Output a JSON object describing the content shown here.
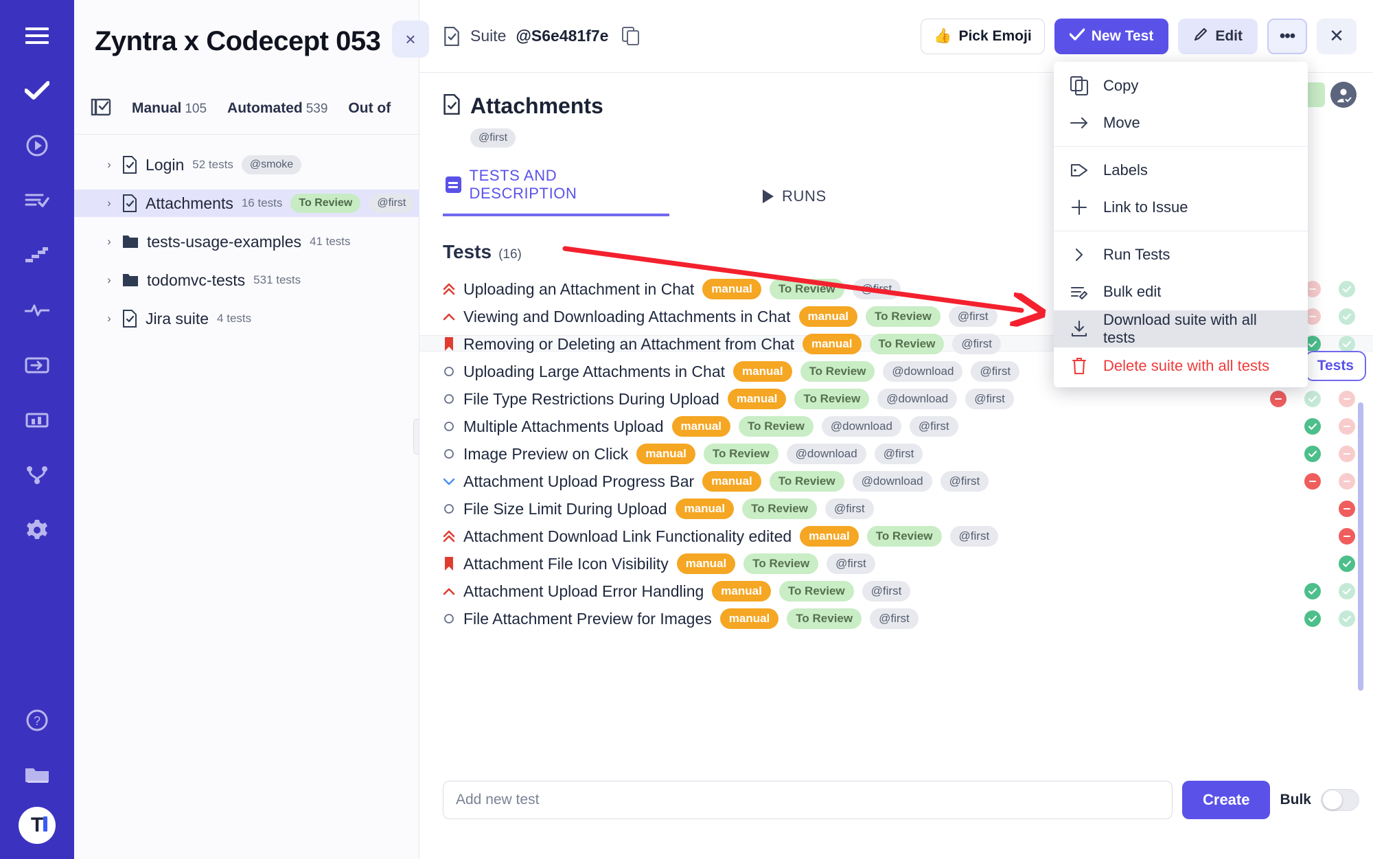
{
  "rail": {
    "icons": [
      {
        "name": "hamburger-menu-icon"
      },
      {
        "name": "check-icon"
      },
      {
        "name": "play-circle-icon"
      },
      {
        "name": "list-check-icon"
      },
      {
        "name": "steps-icon"
      },
      {
        "name": "activity-pulse-icon"
      },
      {
        "name": "import-icon"
      },
      {
        "name": "chart-bar-icon"
      },
      {
        "name": "share-nodes-icon"
      },
      {
        "name": "gear-icon"
      },
      {
        "name": "help-circle-icon"
      },
      {
        "name": "folder-icon"
      }
    ],
    "logo_letter": "T"
  },
  "panel": {
    "title": "Zyntra x Codecept 053",
    "close_label": "×",
    "tabs": [
      {
        "label": "Manual",
        "count": "105"
      },
      {
        "label": "Automated",
        "count": "539"
      },
      {
        "label": "Out of",
        "count": ""
      }
    ],
    "tree": [
      {
        "name": "Login",
        "count": "52 tests",
        "icon": "file-check-icon",
        "tags": [
          {
            "text": "@smoke",
            "kind": "grey"
          }
        ],
        "selected": false
      },
      {
        "name": "Attachments",
        "count": "16 tests",
        "icon": "file-check-icon",
        "tags": [
          {
            "text": "To Review",
            "kind": "green"
          },
          {
            "text": "@first",
            "kind": "grey"
          }
        ],
        "selected": true
      },
      {
        "name": "tests-usage-examples",
        "count": "41 tests",
        "icon": "folder-icon",
        "tags": [],
        "selected": false
      },
      {
        "name": "todomvc-tests",
        "count": "531 tests",
        "icon": "folder-icon",
        "tags": [],
        "selected": false
      },
      {
        "name": "Jira suite",
        "count": "4 tests",
        "icon": "file-check-icon",
        "tags": [],
        "selected": false
      }
    ]
  },
  "header": {
    "suite_word": "Suite",
    "suite_id": "@S6e481f7e",
    "buttons": {
      "pick_emoji": "Pick Emoji",
      "emoji_glyph": "👍",
      "new_test": "New Test",
      "edit": "Edit",
      "more": "•••",
      "close": "✕"
    }
  },
  "suite": {
    "title": "Attachments",
    "tag": "@first",
    "tabs": [
      {
        "label": "TESTS AND DESCRIPTION",
        "active": true
      },
      {
        "label": "RUNS",
        "active": false
      }
    ],
    "tests_heading": "Tests",
    "tests_count": "(16)",
    "side_chip": "Tests",
    "side_peek": "ests"
  },
  "menu": {
    "items": [
      {
        "label": "Copy",
        "icon": "copy-icon",
        "state": "normal"
      },
      {
        "label": "Move",
        "icon": "arrow-right-icon",
        "state": "normal"
      },
      {
        "sep": true
      },
      {
        "label": "Labels",
        "icon": "tag-icon",
        "state": "normal"
      },
      {
        "label": "Link to Issue",
        "icon": "plus-icon",
        "state": "normal"
      },
      {
        "sep": true
      },
      {
        "label": "Run Tests",
        "icon": "chevron-right-icon",
        "state": "normal"
      },
      {
        "label": "Bulk edit",
        "icon": "bulk-edit-icon",
        "state": "normal"
      },
      {
        "label": "Download suite with all tests",
        "icon": "download-icon",
        "state": "highlighted"
      },
      {
        "label": "Delete suite with all tests",
        "icon": "trash-icon",
        "state": "danger"
      }
    ]
  },
  "tests": [
    {
      "title": "Uploading an Attachment in Chat",
      "priority": "highest",
      "tags": [
        {
          "text": "manual",
          "kind": "manual"
        },
        {
          "text": "To Review",
          "kind": "review"
        },
        {
          "text": "@first",
          "kind": "at"
        }
      ],
      "statuses": [
        "fail-faded",
        "pass-faded"
      ]
    },
    {
      "title": "Viewing and Downloading Attachments in Chat",
      "priority": "high",
      "tags": [
        {
          "text": "manual",
          "kind": "manual"
        },
        {
          "text": "To Review",
          "kind": "review"
        },
        {
          "text": "@first",
          "kind": "at"
        }
      ],
      "statuses": [
        "pass",
        "fail",
        "fail-faded",
        "pass-faded"
      ]
    },
    {
      "title": "Removing or Deleting an Attachment from Chat",
      "priority": "blocker",
      "tags": [
        {
          "text": "manual",
          "kind": "manual"
        },
        {
          "text": "To Review",
          "kind": "review"
        },
        {
          "text": "@first",
          "kind": "at"
        }
      ],
      "statuses": [
        "pass",
        "pass-faded"
      ]
    },
    {
      "title": "Uploading Large Attachments in Chat",
      "priority": "normal",
      "tags": [
        {
          "text": "manual",
          "kind": "manual"
        },
        {
          "text": "To Review",
          "kind": "review"
        },
        {
          "text": "@download",
          "kind": "at"
        },
        {
          "text": "@first",
          "kind": "at"
        }
      ],
      "statuses": [
        "pass",
        "pass-faded"
      ]
    },
    {
      "title": "File Type Restrictions During Upload",
      "priority": "normal",
      "tags": [
        {
          "text": "manual",
          "kind": "manual"
        },
        {
          "text": "To Review",
          "kind": "review"
        },
        {
          "text": "@download",
          "kind": "at"
        },
        {
          "text": "@first",
          "kind": "at"
        }
      ],
      "statuses": [
        "fail",
        "pass-faded",
        "fail-faded"
      ]
    },
    {
      "title": "Multiple Attachments Upload",
      "priority": "normal",
      "tags": [
        {
          "text": "manual",
          "kind": "manual"
        },
        {
          "text": "To Review",
          "kind": "review"
        },
        {
          "text": "@download",
          "kind": "at"
        },
        {
          "text": "@first",
          "kind": "at"
        }
      ],
      "statuses": [
        "pass",
        "fail-faded"
      ]
    },
    {
      "title": "Image Preview on Click",
      "priority": "normal",
      "tags": [
        {
          "text": "manual",
          "kind": "manual"
        },
        {
          "text": "To Review",
          "kind": "review"
        },
        {
          "text": "@download",
          "kind": "at"
        },
        {
          "text": "@first",
          "kind": "at"
        }
      ],
      "statuses": [
        "pass",
        "fail-faded"
      ]
    },
    {
      "title": "Attachment Upload Progress Bar",
      "priority": "low",
      "tags": [
        {
          "text": "manual",
          "kind": "manual"
        },
        {
          "text": "To Review",
          "kind": "review"
        },
        {
          "text": "@download",
          "kind": "at"
        },
        {
          "text": "@first",
          "kind": "at"
        }
      ],
      "statuses": [
        "fail",
        "fail-faded"
      ]
    },
    {
      "title": "File Size Limit During Upload",
      "priority": "normal",
      "tags": [
        {
          "text": "manual",
          "kind": "manual"
        },
        {
          "text": "To Review",
          "kind": "review"
        },
        {
          "text": "@first",
          "kind": "at"
        }
      ],
      "statuses": [
        "fail"
      ]
    },
    {
      "title": "Attachment Download Link Functionality edited",
      "priority": "highest",
      "tags": [
        {
          "text": "manual",
          "kind": "manual"
        },
        {
          "text": "To Review",
          "kind": "review"
        },
        {
          "text": "@first",
          "kind": "at"
        }
      ],
      "statuses": [
        "fail"
      ]
    },
    {
      "title": "Attachment File Icon Visibility",
      "priority": "blocker",
      "tags": [
        {
          "text": "manual",
          "kind": "manual"
        },
        {
          "text": "To Review",
          "kind": "review"
        },
        {
          "text": "@first",
          "kind": "at"
        }
      ],
      "statuses": [
        "pass"
      ]
    },
    {
      "title": "Attachment Upload Error Handling",
      "priority": "high",
      "tags": [
        {
          "text": "manual",
          "kind": "manual"
        },
        {
          "text": "To Review",
          "kind": "review"
        },
        {
          "text": "@first",
          "kind": "at"
        }
      ],
      "statuses": [
        "pass",
        "pass-faded"
      ]
    },
    {
      "title": "File Attachment Preview for Images",
      "priority": "normal",
      "tags": [
        {
          "text": "manual",
          "kind": "manual"
        },
        {
          "text": "To Review",
          "kind": "review"
        },
        {
          "text": "@first",
          "kind": "at"
        }
      ],
      "statuses": [
        "pass",
        "pass-faded"
      ]
    }
  ],
  "footer": {
    "add_placeholder": "Add new test",
    "add_value": "",
    "create_label": "Create",
    "bulk_label": "Bulk"
  },
  "colors": {
    "brand": "#5a52e8",
    "rail": "#3b33bf",
    "manual_tag": "#f5a623",
    "review_tag": "#c9edc5",
    "danger": "#ef3b3b",
    "pass": "#4cbf8b",
    "fail": "#ef5d5d",
    "annotation_arrow": "#f3212e"
  }
}
